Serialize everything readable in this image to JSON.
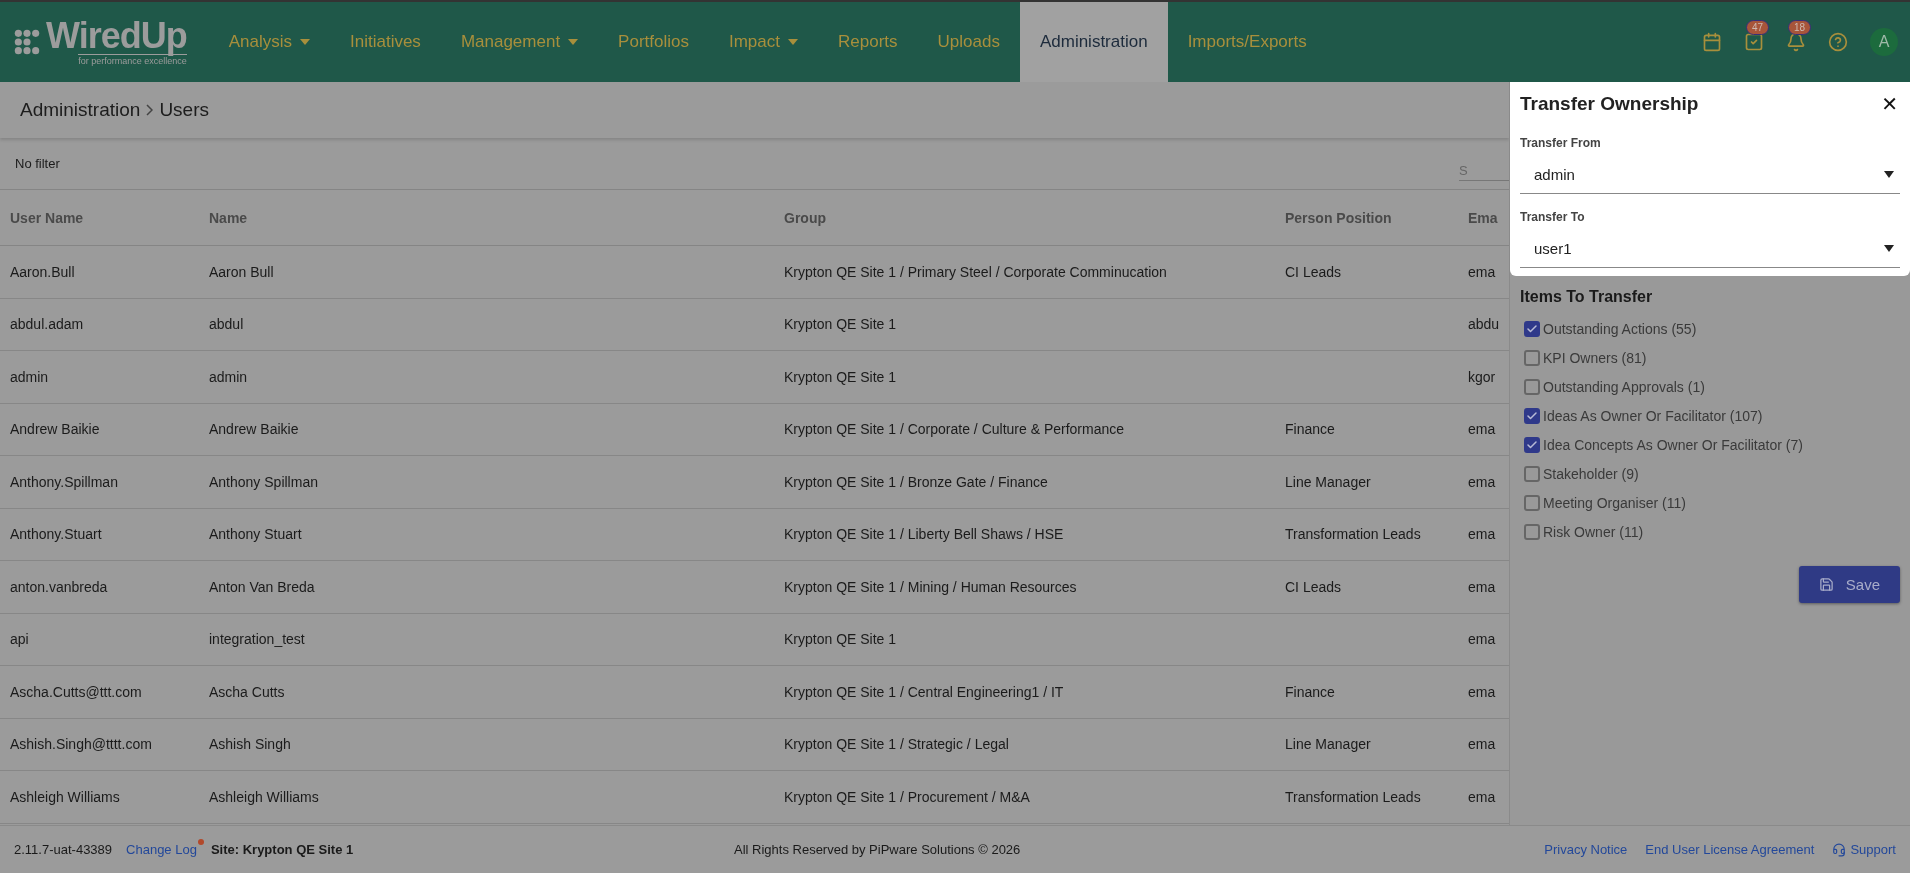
{
  "brand": {
    "name": "WiredUp",
    "tagline": "for performance excellence"
  },
  "nav": [
    {
      "label": "Analysis",
      "has_menu": true,
      "selected": false
    },
    {
      "label": "Initiatives",
      "has_menu": false,
      "selected": false
    },
    {
      "label": "Management",
      "has_menu": true,
      "selected": false
    },
    {
      "label": "Portfolios",
      "has_menu": false,
      "selected": false
    },
    {
      "label": "Impact",
      "has_menu": true,
      "selected": false
    },
    {
      "label": "Reports",
      "has_menu": false,
      "selected": false
    },
    {
      "label": "Uploads",
      "has_menu": false,
      "selected": false
    },
    {
      "label": "Administration",
      "has_menu": false,
      "selected": true
    },
    {
      "label": "Imports/Exports",
      "has_menu": false,
      "selected": false
    }
  ],
  "header_icons": [
    {
      "kind": "calendar"
    },
    {
      "kind": "tasks",
      "badge": "47"
    },
    {
      "kind": "bell",
      "badge": "18"
    },
    {
      "kind": "help"
    }
  ],
  "avatar": "A",
  "breadcrumb": [
    "Administration",
    "Users"
  ],
  "filter": {
    "label": "No filter",
    "search_placeholder": "S"
  },
  "table": {
    "columns": [
      "User Name",
      "Name",
      "Group",
      "Person Position",
      "Ema"
    ],
    "rows": [
      [
        "Aaron.Bull",
        "Aaron Bull",
        "Krypton QE Site 1 / Primary Steel / Corporate Comminucation",
        "CI Leads",
        "ema"
      ],
      [
        "abdul.adam",
        "abdul",
        "Krypton QE Site 1",
        "",
        "abdu"
      ],
      [
        "admin",
        "admin",
        "Krypton QE Site 1",
        "",
        "kgor"
      ],
      [
        "Andrew Baikie",
        "Andrew Baikie",
        "Krypton QE Site 1 / Corporate / Culture & Performance",
        "Finance",
        "ema"
      ],
      [
        "Anthony.Spillman",
        "Anthony Spillman",
        "Krypton QE Site 1 / Bronze Gate / Finance",
        "Line Manager",
        "ema"
      ],
      [
        "Anthony.Stuart",
        "Anthony Stuart",
        "Krypton QE Site 1 / Liberty Bell Shaws / HSE",
        "Transformation Leads",
        "ema"
      ],
      [
        "anton.vanbreda",
        "Anton Van Breda",
        "Krypton QE Site 1 / Mining / Human Resources",
        "CI Leads",
        "ema"
      ],
      [
        "api",
        "integration_test",
        "Krypton QE Site 1",
        "",
        "ema"
      ],
      [
        "Ascha.Cutts@ttt.com",
        "Ascha Cutts",
        "Krypton QE Site 1 / Central Engineering1 / IT",
        "Finance",
        "ema"
      ],
      [
        "Ashish.Singh@tttt.com",
        "Ashish Singh",
        "Krypton QE Site 1 / Strategic / Legal",
        "Line Manager",
        "ema"
      ],
      [
        "Ashleigh Williams",
        "Ashleigh Williams",
        "Krypton QE Site 1 / Procurement / M&A",
        "Transformation Leads",
        "ema"
      ]
    ]
  },
  "panel": {
    "title": "Transfer Ownership",
    "close": "✕",
    "fields": [
      {
        "label": "Transfer From",
        "value": "admin"
      },
      {
        "label": "Transfer To",
        "value": "user1"
      }
    ],
    "items_title": "Items To Transfer",
    "items": [
      {
        "label": "Outstanding Actions (55)",
        "checked": true
      },
      {
        "label": "KPI Owners (81)",
        "checked": false
      },
      {
        "label": "Outstanding Approvals (1)",
        "checked": false
      },
      {
        "label": "Ideas As Owner Or Facilitator (107)",
        "checked": true
      },
      {
        "label": "Idea Concepts As Owner Or Facilitator (7)",
        "checked": true
      },
      {
        "label": "Stakeholder (9)",
        "checked": false
      },
      {
        "label": "Meeting Organiser (11)",
        "checked": false
      },
      {
        "label": "Risk Owner (11)",
        "checked": false
      }
    ],
    "save": "Save"
  },
  "footer": {
    "version": "2.11.7-uat-43389",
    "change_log": "Change Log",
    "change_log_dot": true,
    "site": "Site: Krypton QE Site 1",
    "copyright": "All Rights Reserved by PiPware Solutions © 2026",
    "links": [
      "Privacy Notice",
      "End User License Agreement",
      "Support"
    ]
  }
}
